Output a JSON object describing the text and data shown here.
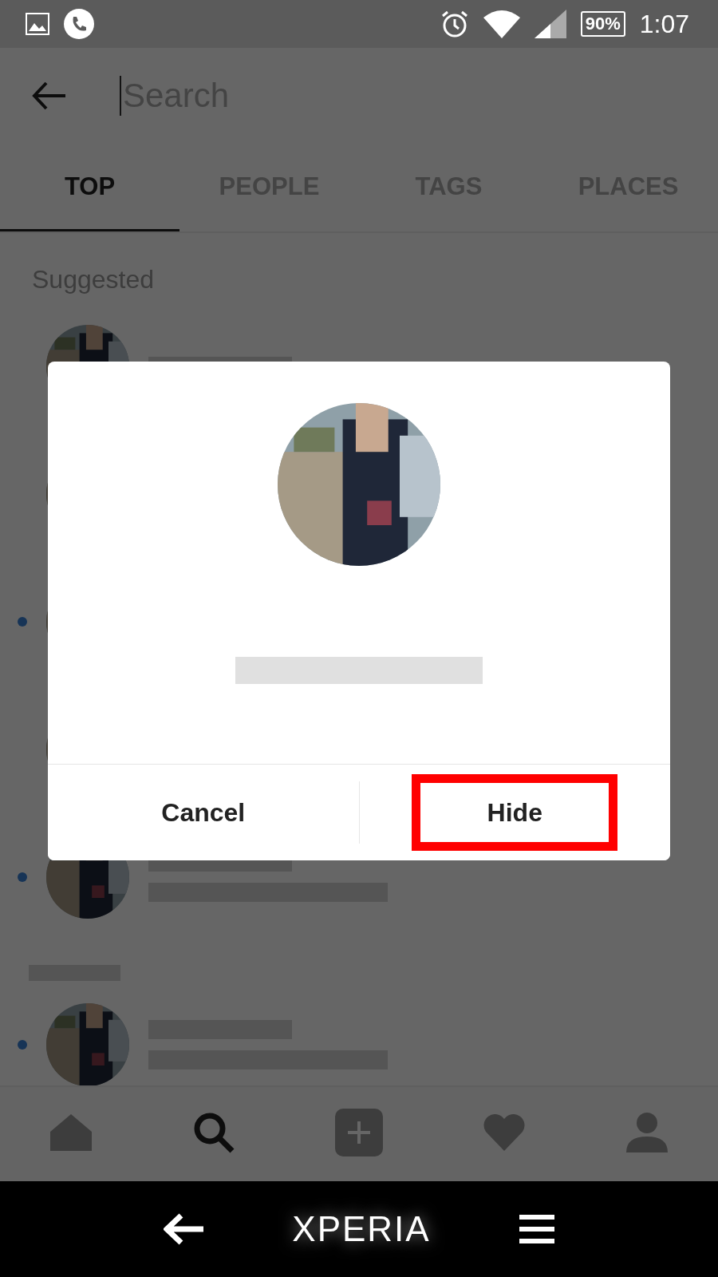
{
  "status_bar": {
    "battery": "90%",
    "time": "1:07"
  },
  "search": {
    "placeholder": "Search"
  },
  "tabs": [
    {
      "label": "TOP",
      "selected": true
    },
    {
      "label": "PEOPLE",
      "selected": false
    },
    {
      "label": "TAGS",
      "selected": false
    },
    {
      "label": "PLACES",
      "selected": false
    }
  ],
  "section_title": "Suggested",
  "rows": [
    {
      "marked": false
    },
    {
      "marked": false
    },
    {
      "marked": true
    },
    {
      "marked": false
    },
    {
      "marked": true
    },
    {
      "marked": true
    }
  ],
  "dialog": {
    "buttons": [
      {
        "label": "Cancel",
        "highlighted": false
      },
      {
        "label": "Hide",
        "highlighted": true
      }
    ]
  },
  "bottom_nav": [
    {
      "kind": "home",
      "selected": false
    },
    {
      "kind": "search",
      "selected": true
    },
    {
      "kind": "add",
      "selected": false
    },
    {
      "kind": "heart",
      "selected": false
    },
    {
      "kind": "profile",
      "selected": false
    }
  ],
  "system_nav": {
    "logo": "XPERIA"
  }
}
